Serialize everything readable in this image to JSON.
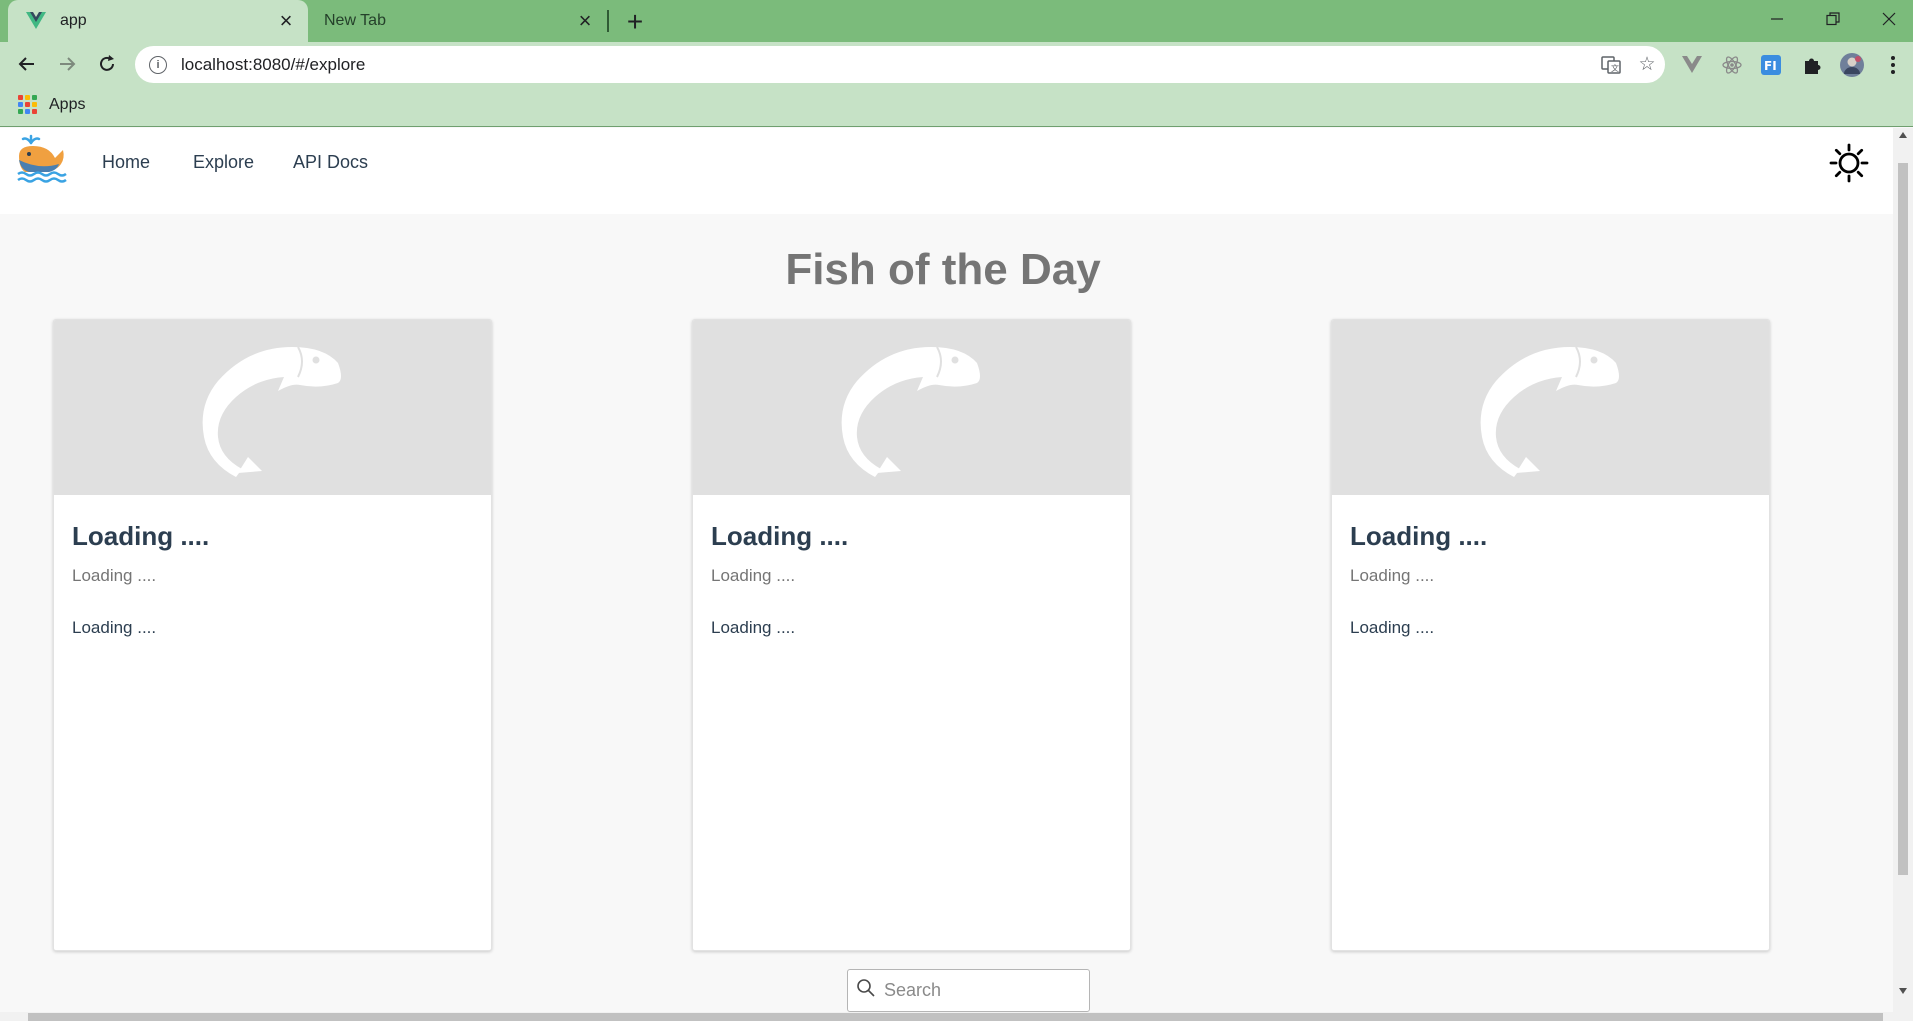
{
  "browser": {
    "tabs": [
      {
        "title": "app",
        "active": true
      },
      {
        "title": "New Tab",
        "active": false
      }
    ],
    "new_tab_symbol": "+",
    "url": "localhost:8080/#/explore",
    "bookmarks": [
      {
        "label": "Apps"
      }
    ],
    "colors": {
      "frame": "#7bbb7b",
      "toolbar": "#c6e2c6"
    }
  },
  "app": {
    "nav": {
      "links": [
        {
          "label": "Home"
        },
        {
          "label": "Explore"
        },
        {
          "label": "API Docs"
        }
      ],
      "theme_icon": "sun-icon"
    },
    "title": "Fish of the Day",
    "cards": [
      {
        "title": "Loading ....",
        "subtitle": "Loading ....",
        "text": "Loading ...."
      },
      {
        "title": "Loading ....",
        "subtitle": "Loading ....",
        "text": "Loading ...."
      },
      {
        "title": "Loading ....",
        "subtitle": "Loading ....",
        "text": "Loading ...."
      }
    ],
    "search": {
      "placeholder": "Search",
      "value": ""
    },
    "colors": {
      "heading": "#757575",
      "text": "#2c3e50",
      "placeholder_bg": "#e0e0e0"
    }
  }
}
